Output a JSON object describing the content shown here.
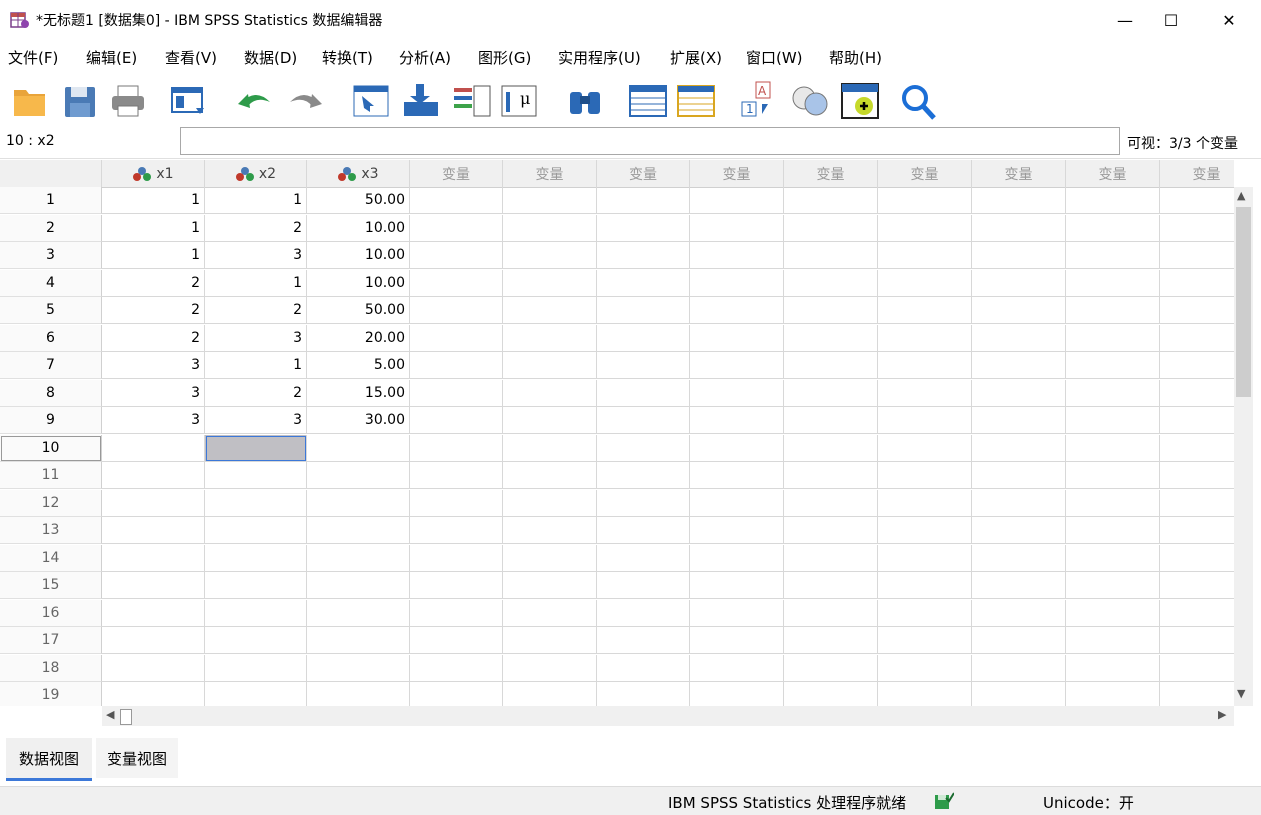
{
  "window": {
    "title": "*无标题1 [数据集0] - IBM SPSS Statistics 数据编辑器",
    "minimize_glyph": "—",
    "maximize_glyph": "☐",
    "close_glyph": "✕"
  },
  "menu": [
    "文件(F)",
    "编辑(E)",
    "查看(V)",
    "数据(D)",
    "转换(T)",
    "分析(A)",
    "图形(G)",
    "实用程序(U)",
    "扩展(X)",
    "窗口(W)",
    "帮助(H)"
  ],
  "toolbar_icons": [
    "open-folder-icon",
    "save-icon",
    "print-icon",
    "recall-dialog-icon",
    "undo-icon",
    "redo-icon",
    "goto-case-icon",
    "goto-variable-icon",
    "variables-icon",
    "run-descriptives-icon",
    "find-icon",
    "insert-cases-icon",
    "insert-variable-icon",
    "split-file-icon",
    "select-cases-icon",
    "value-labels-icon",
    "use-variable-sets-icon",
    "search-icon"
  ],
  "cellbar": {
    "cell_ref": "10 : x2",
    "cell_value": "",
    "visible_label": "可视：3/3 个变量"
  },
  "grid": {
    "columns": [
      "x1",
      "x2",
      "x3"
    ],
    "empty_column_label": "变量",
    "empty_column_count": 9,
    "rows": [
      [
        "1",
        "1",
        "50.00"
      ],
      [
        "1",
        "2",
        "10.00"
      ],
      [
        "1",
        "3",
        "10.00"
      ],
      [
        "2",
        "1",
        "10.00"
      ],
      [
        "2",
        "2",
        "50.00"
      ],
      [
        "2",
        "3",
        "20.00"
      ],
      [
        "3",
        "1",
        "5.00"
      ],
      [
        "3",
        "2",
        "15.00"
      ],
      [
        "3",
        "3",
        "30.00"
      ]
    ],
    "visible_row_count": 19,
    "selected_cell": {
      "row": 10,
      "column": "x2"
    }
  },
  "tabs": {
    "data_view": "数据视图",
    "variable_view": "变量视图",
    "active": "data_view"
  },
  "status": {
    "processor": "IBM SPSS Statistics 处理程序就绪",
    "unicode": "Unicode：开"
  },
  "colors": {
    "selected_cell": "#c0bfc4",
    "selected_border": "#3c78d8",
    "tab_underline": "#3c78d8"
  }
}
